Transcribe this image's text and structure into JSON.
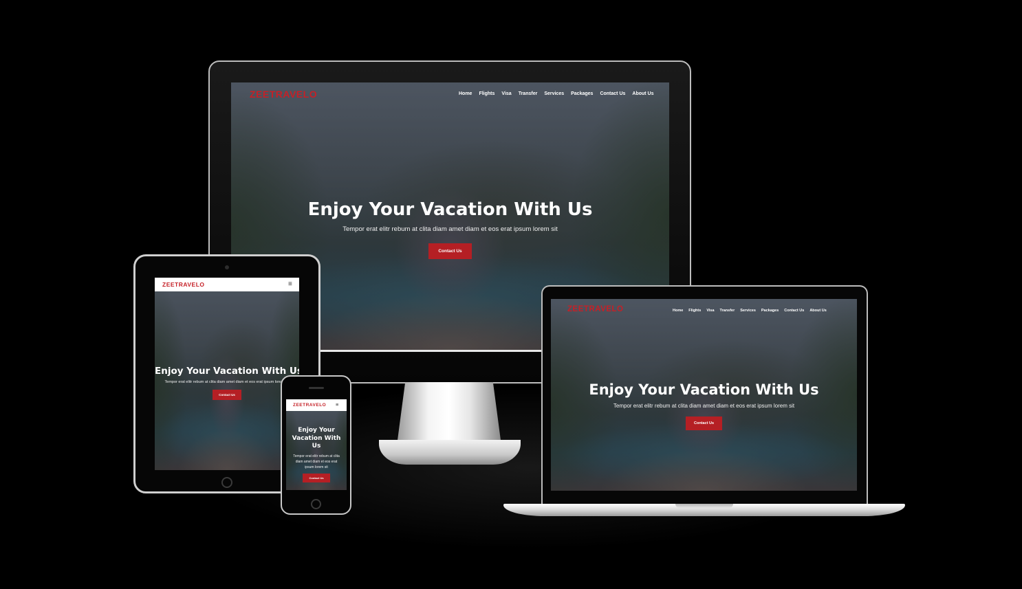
{
  "brand": "ZEETRAVELO",
  "nav": [
    "Home",
    "Flights",
    "Visa",
    "Transfer",
    "Services",
    "Packages",
    "Contact Us",
    "About Us"
  ],
  "hero": {
    "title": "Enjoy Your Vacation With Us",
    "subtitle": "Tempor erat elitr rebum at clita diam amet diam et eos erat ipsum lorem sit",
    "cta": "Contact Us"
  },
  "mobile": {
    "menu_icon": "hamburger-menu-icon",
    "menu_glyph": "≡"
  },
  "colors": {
    "brand_red": "#c52027",
    "button_red": "#b51f24",
    "background": "#000000"
  }
}
